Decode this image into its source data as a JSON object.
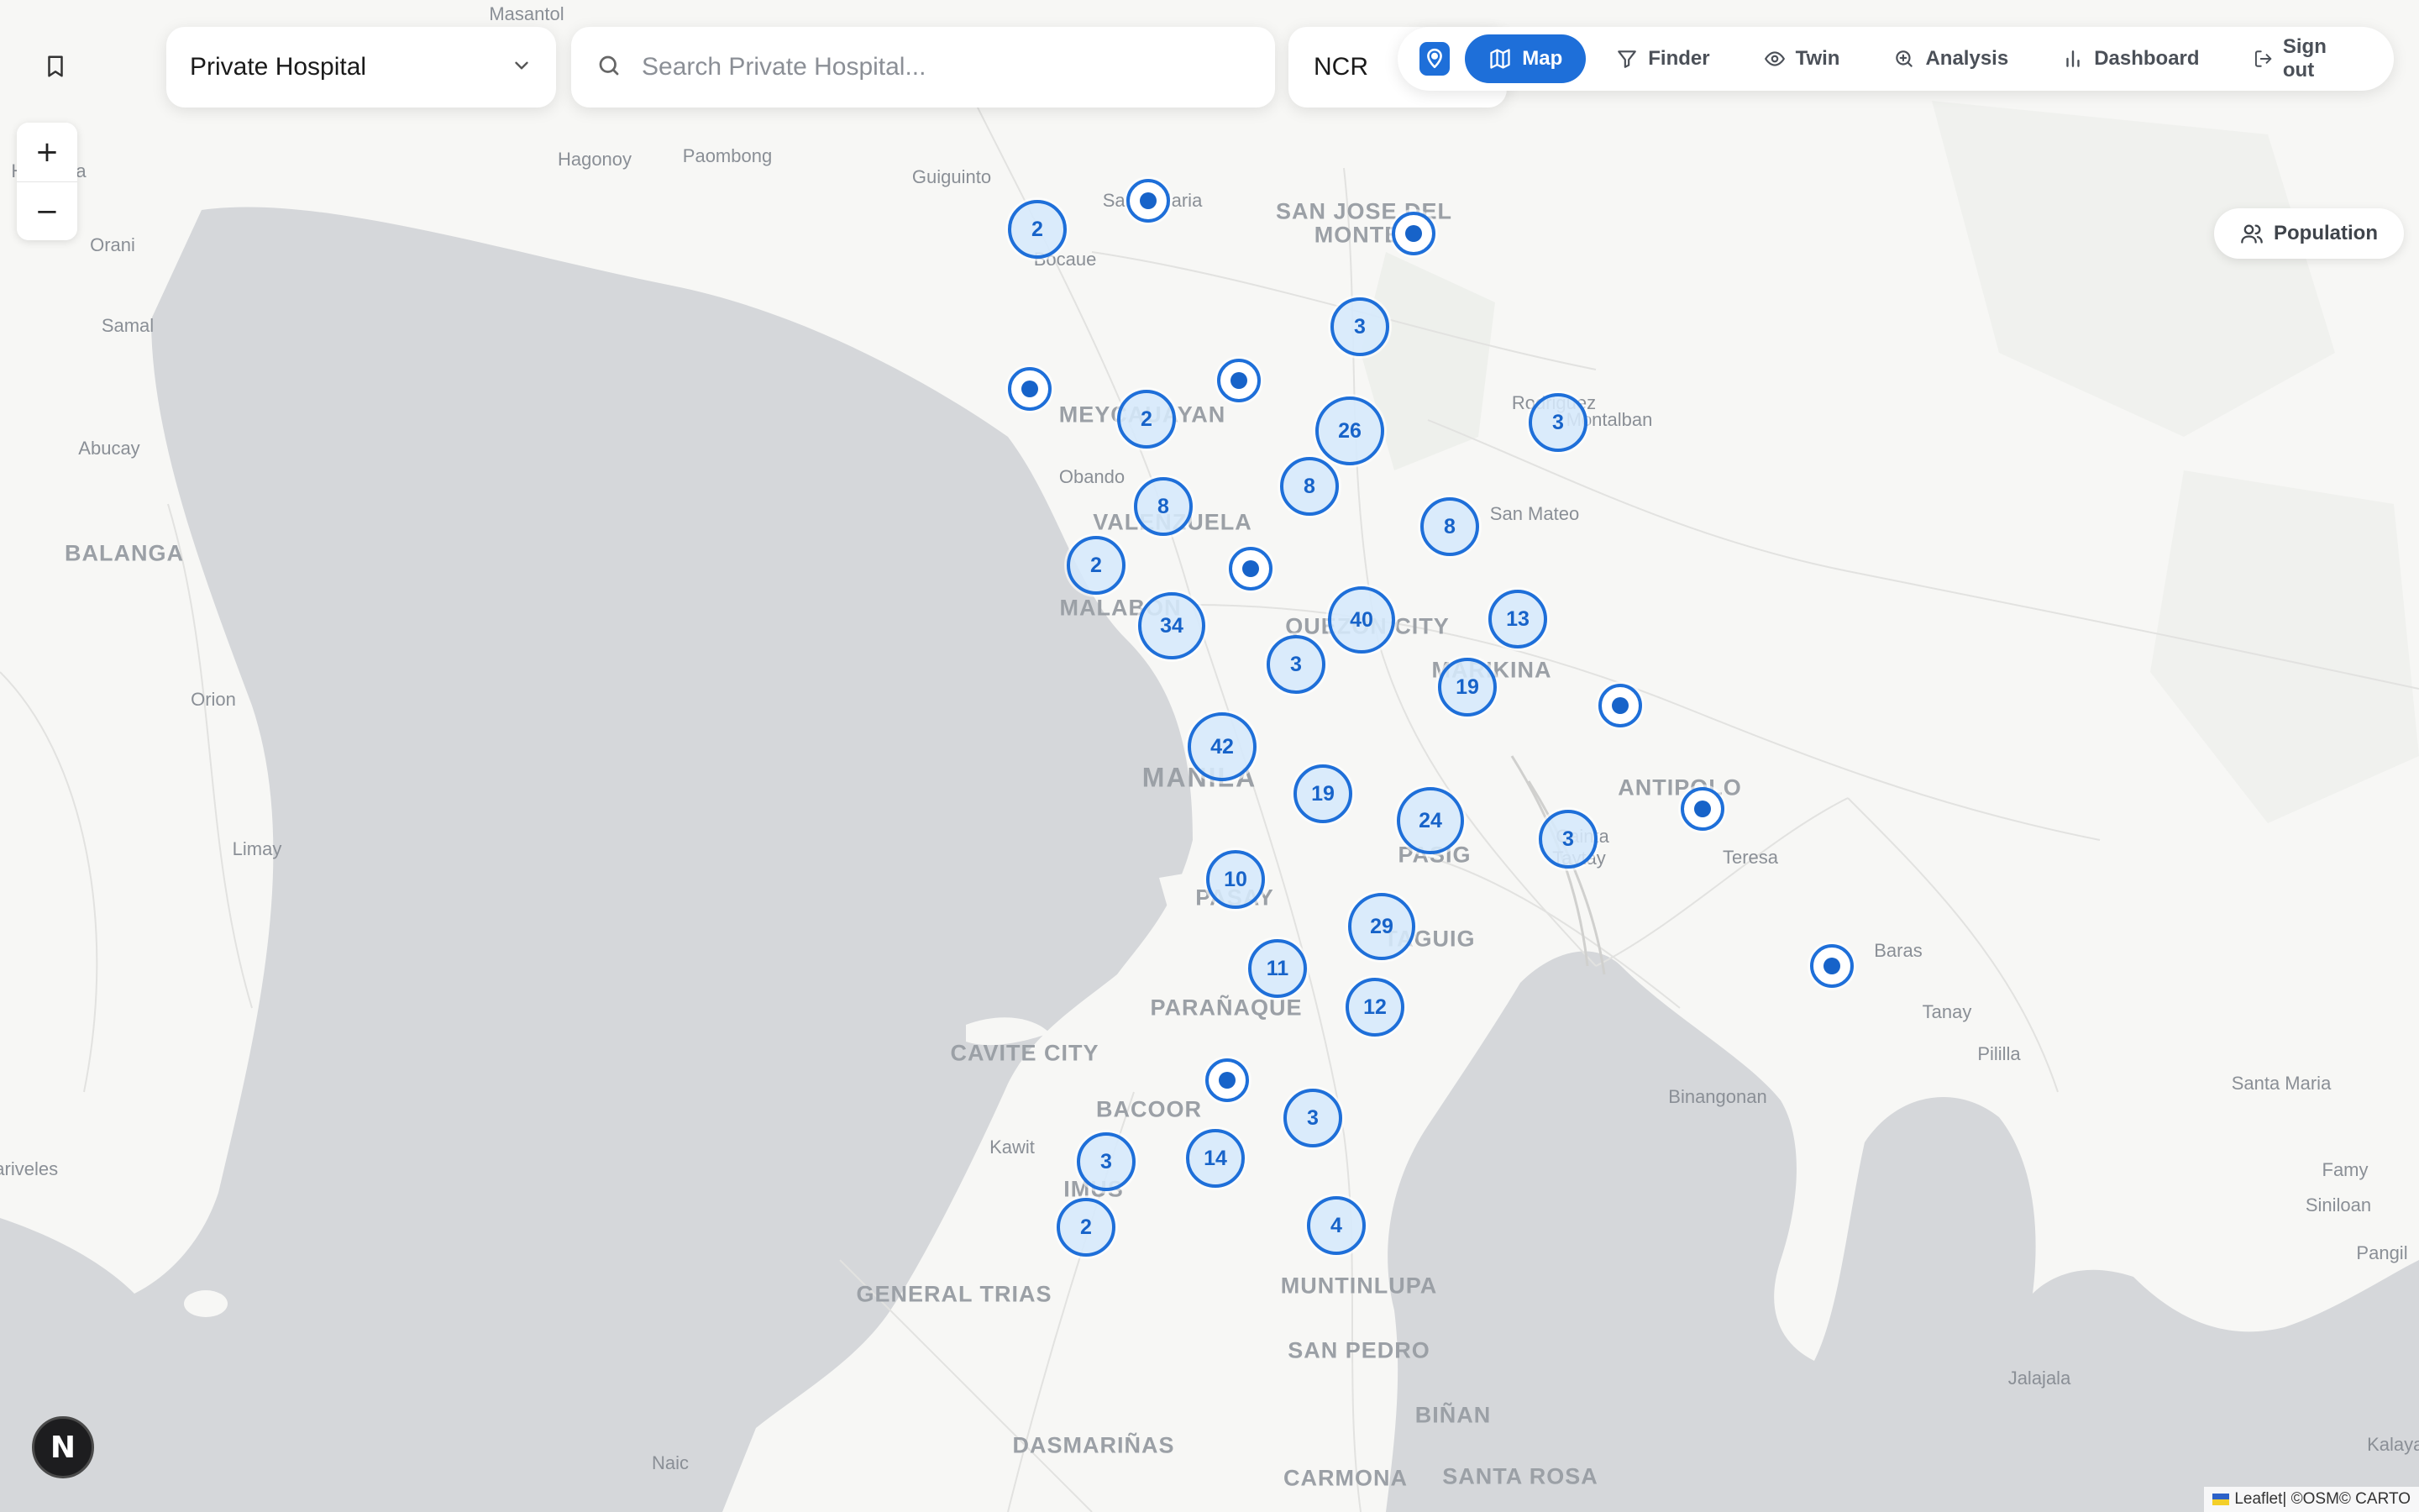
{
  "filters": {
    "facility_type": "Private Hospital",
    "search_placeholder": "Search Private Hospital...",
    "region": "NCR"
  },
  "nav": {
    "items": [
      {
        "label": "Map",
        "icon": "map-icon",
        "active": true
      },
      {
        "label": "Finder",
        "icon": "filter-icon",
        "active": false
      },
      {
        "label": "Twin",
        "icon": "eye-icon",
        "active": false
      },
      {
        "label": "Analysis",
        "icon": "zoom-search-icon",
        "active": false
      },
      {
        "label": "Dashboard",
        "icon": "bar-chart-icon",
        "active": false
      },
      {
        "label": "Sign out",
        "icon": "logout-icon",
        "active": false
      }
    ]
  },
  "layers": {
    "population_label": "Population"
  },
  "zoom": {
    "in": "+",
    "out": "−"
  },
  "badge": {
    "letter": "N"
  },
  "attribution": {
    "leaflet": "Leaflet",
    "sep": " | © ",
    "osm": "OSM",
    "carto": " © CARTO"
  },
  "colors": {
    "accent": "#1e6fd9",
    "water": "#d5d7da",
    "land": "#f7f7f5"
  },
  "clusters": [
    {
      "count": "2"
    },
    {
      "count": "3"
    },
    {
      "count": "2"
    },
    {
      "count": "26"
    },
    {
      "count": "3"
    },
    {
      "count": "8"
    },
    {
      "count": "8"
    },
    {
      "count": "8"
    },
    {
      "count": "2"
    },
    {
      "count": "34"
    },
    {
      "count": "40"
    },
    {
      "count": "13"
    },
    {
      "count": "3"
    },
    {
      "count": "19"
    },
    {
      "count": "42"
    },
    {
      "count": "19"
    },
    {
      "count": "24"
    },
    {
      "count": "3"
    },
    {
      "count": "10"
    },
    {
      "count": "29"
    },
    {
      "count": "11"
    },
    {
      "count": "12"
    },
    {
      "count": "3"
    },
    {
      "count": "3"
    },
    {
      "count": "14"
    },
    {
      "count": "2"
    },
    {
      "count": "4"
    }
  ],
  "places": [
    "Masantol",
    "Hagonoy",
    "Paombong",
    "Guiguinto",
    "Santa Maria",
    "SAN JOSE DEL",
    "MONTE",
    "Orani",
    "Hermosa",
    "Samal",
    "Abucay",
    "BALANGA",
    "Bocaue",
    "MEYCAUAYAN",
    "Obando",
    "Rodriguez",
    "Montalban",
    "VALENZUELA",
    "San Mateo",
    "MALABON",
    "QUEZON CITY",
    "MARIKINA",
    "Orion",
    "MANILA",
    "ANTIPOLO",
    "Limay",
    "Teresa",
    "PASIG",
    "Cainta",
    "Taytay",
    "PASAY",
    "TAGUIG",
    "Baras",
    "Tanay",
    "Pililla",
    "PARAÑAQUE",
    "CAVITE CITY",
    "BACOOR",
    "Kawit",
    "Binangonan",
    "Santa Maria",
    "IMUS",
    "Mariveles",
    "Famy",
    "Siniloan",
    "Pangil",
    "GENERAL TRIAS",
    "MUNTINLUPA",
    "SAN PEDRO",
    "BIÑAN",
    "Jalajala",
    "Naic",
    "DASMARIÑAS",
    "CARMONA",
    "SANTA ROSA",
    "Kalayaan"
  ]
}
